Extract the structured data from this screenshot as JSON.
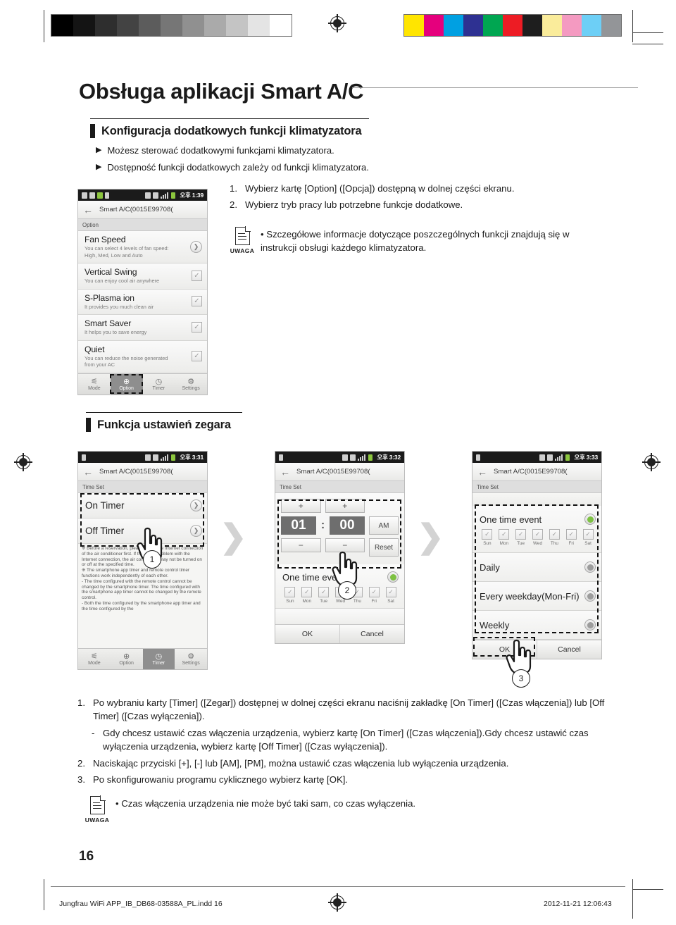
{
  "print_marks": {
    "grayscale_steps": [
      "#000000",
      "#141414",
      "#2e2e2e",
      "#434343",
      "#5c5c5c",
      "#767676",
      "#909090",
      "#aaaaaa",
      "#c4c4c4",
      "#e4e4e4",
      "#ffffff"
    ],
    "color_swatches": [
      "#ffe500",
      "#e5007d",
      "#00a0e2",
      "#2e3192",
      "#00a651",
      "#ed1c24",
      "#1e1e1e",
      "#faec9b",
      "#f49ac1",
      "#6dcff6",
      "#939598"
    ]
  },
  "header": {
    "title": "Obsługa aplikacji Smart A/C"
  },
  "section1": {
    "heading": "Konfiguracja dodatkowych funkcji klimatyzatora",
    "bullets": [
      "Możesz sterować dodatkowymi funkcjami klimatyzatora.",
      "Dostępność funkcji dodatkowych zależy od funkcji klimatyzatora."
    ],
    "steps": [
      {
        "n": "1.",
        "t": "Wybierz kartę [Option] ([Opcja]) dostępną w dolnej części ekranu."
      },
      {
        "n": "2.",
        "t": "Wybierz tryb pracy lub potrzebne funkcje dodatkowe."
      }
    ],
    "note": {
      "label": "UWAGA",
      "text": "• Szczegółowe informacje dotyczące poszczególnych funkcji znajdują się w instrukcji obsługi każdego klimatyzatora."
    }
  },
  "phone_option": {
    "status": {
      "clock": "오후 1:39"
    },
    "titlebar": {
      "back_icon": "arrow-left-icon",
      "title": "Smart A/C(0015E99708("
    },
    "subbar": "Option",
    "rows": [
      {
        "title": "Fan Speed",
        "desc": "You can select 4 levels of fan speed:\nHigh, Med, Low and Auto",
        "control": "chevron"
      },
      {
        "title": "Vertical Swing",
        "desc": "You can enjoy cool air anywhere",
        "control": "check"
      },
      {
        "title": "S-Plasma ion",
        "desc": "It provides you much clean air",
        "control": "check"
      },
      {
        "title": "Smart Saver",
        "desc": "It helps you to save energy",
        "control": "check"
      },
      {
        "title": "Quiet",
        "desc": "You can reduce the noise generated\nfrom your AC",
        "control": "check"
      }
    ],
    "nav": [
      {
        "label": "Mode",
        "icon": "mode-icon",
        "selected": false
      },
      {
        "label": "Option",
        "icon": "plus-circle-icon",
        "selected": true
      },
      {
        "label": "Timer",
        "icon": "clock-icon",
        "selected": false
      },
      {
        "label": "Settings",
        "icon": "gear-icon",
        "selected": false
      }
    ]
  },
  "section2": {
    "heading": "Funkcja ustawień zegara"
  },
  "phone_timer1": {
    "status": {
      "clock": "오후 3:31"
    },
    "titlebar": {
      "title": "Smart A/C(0015E99708("
    },
    "subbar": "Time Set",
    "rows": [
      {
        "title": "On Timer"
      },
      {
        "title": "Off Timer"
      }
    ],
    "note_text": "※ Before a reservation, please check the Internet connection of the air conditioner first. If there is a problem with the Internet connection, the air conditioner may not be turned on or off at the specified time.\n※ The smartphone app timer and remote control timer functions work independently of each other.\n- The time configured with the remote control cannot be changed by the smartphone timer. The time configured with the smartphone app timer cannot be changed by the remote control.\n- Both the time configured by the smartphone app timer and the time configured by the",
    "nav": [
      {
        "label": "Mode",
        "selected": false
      },
      {
        "label": "Option",
        "selected": false
      },
      {
        "label": "Timer",
        "selected": true
      },
      {
        "label": "Settings",
        "selected": false
      }
    ],
    "callout": "1"
  },
  "phone_timer2": {
    "status": {
      "clock": "오후 3:32"
    },
    "titlebar": {
      "title": "Smart A/C(0015E99708("
    },
    "subbar": "Time Set",
    "time": {
      "hour": "01",
      "separator": ":",
      "minute": "00",
      "meridiem": "AM",
      "reset": "Reset",
      "plus": "+",
      "minus": "−"
    },
    "event": {
      "label": "One time event",
      "days": [
        "Sun",
        "Mon",
        "Tue",
        "Wed",
        "Thu",
        "Fri",
        "Sat"
      ]
    },
    "buttons": {
      "ok": "OK",
      "cancel": "Cancel"
    },
    "callout": "2"
  },
  "phone_timer3": {
    "status": {
      "clock": "오후 3:33"
    },
    "titlebar": {
      "title": "Smart A/C(0015E99708("
    },
    "subbar": "Time Set",
    "options": [
      {
        "label": "One time event",
        "selected": true
      },
      {
        "label": "Daily",
        "selected": false
      },
      {
        "label": "Every weekday(Mon-Fri)",
        "selected": false
      },
      {
        "label": "Weekly",
        "selected": false
      }
    ],
    "days": [
      "Sun",
      "Mon",
      "Tue",
      "Wed",
      "Thu",
      "Fri",
      "Sat"
    ],
    "buttons": {
      "ok": "OK",
      "cancel": "Cancel"
    },
    "callout": "3"
  },
  "section2_steps": [
    {
      "n": "1.",
      "t": "Po wybraniu karty [Timer] ([Zegar]) dostępnej w dolnej części ekranu naciśnij zakładkę [On Timer] ([Czas włączenia]) lub [Off Timer] ([Czas wyłączenia])."
    },
    {
      "n": "-",
      "t": "Gdy chcesz ustawić czas włączenia urządzenia, wybierz kartę [On Timer] ([Czas włączenia]).Gdy chcesz ustawić czas wyłączenia urządzenia, wybierz kartę [Off Timer] ([Czas wyłączenia])."
    },
    {
      "n": "2.",
      "t": "Naciskając przyciski [+], [-] lub [AM], [PM], można ustawić czas włączenia lub wyłączenia urządzenia."
    },
    {
      "n": "3.",
      "t": "Po skonfigurowaniu programu cyklicznego wybierz kartę [OK]."
    }
  ],
  "section2_note": {
    "label": "UWAGA",
    "text": "• Czas włączenia urządzenia nie może być taki sam, co czas wyłączenia."
  },
  "page_number": "16",
  "footer": {
    "file": "Jungfrau WiFi APP_IB_DB68-03588A_PL.indd   16",
    "timestamp": "2012-11-21   12:06:43"
  }
}
